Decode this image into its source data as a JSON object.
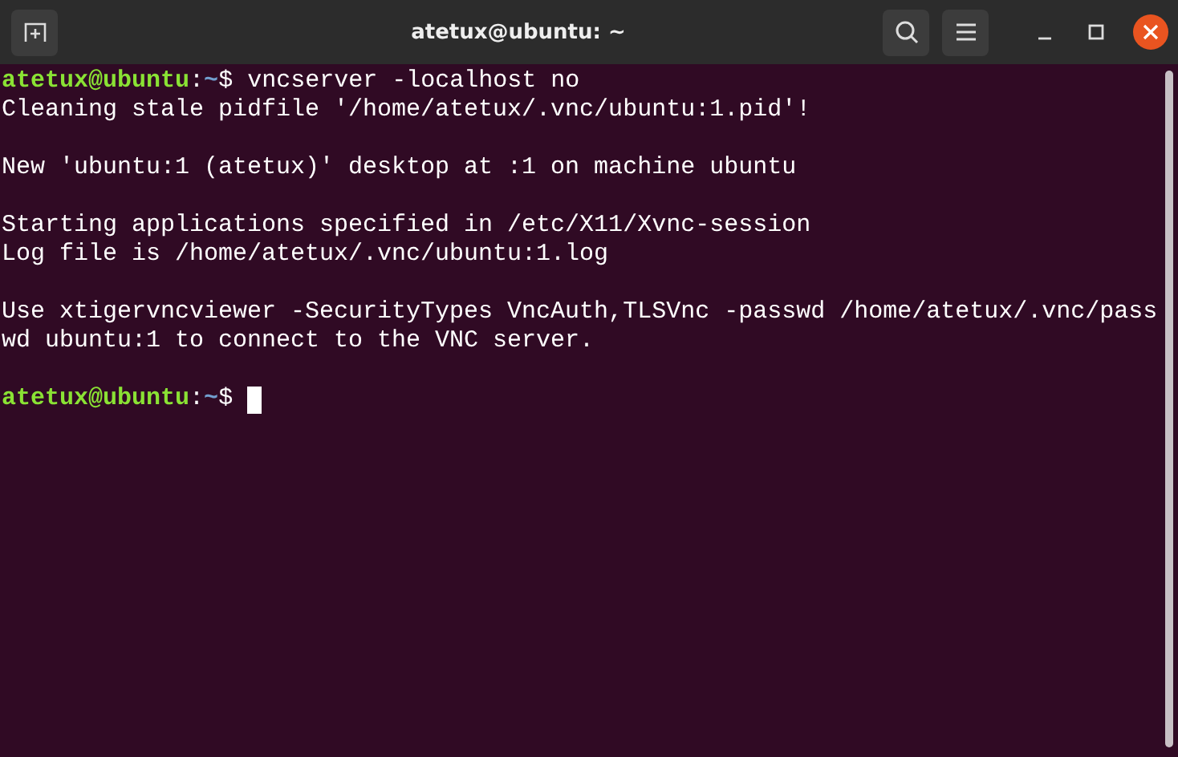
{
  "window": {
    "title": "atetux@ubuntu: ~"
  },
  "terminal": {
    "lines": [
      {
        "kind": "text",
        "segments": [
          {
            "kind": "user",
            "text": "atetux@ubuntu"
          },
          {
            "kind": "plain",
            "text": ":"
          },
          {
            "kind": "path",
            "text": "~"
          },
          {
            "kind": "plain",
            "text": "$ vncserver -localhost no"
          }
        ]
      },
      {
        "kind": "text",
        "segments": [
          {
            "kind": "plain",
            "text": "Cleaning stale pidfile '/home/atetux/.vnc/ubuntu:1.pid'!"
          }
        ]
      },
      {
        "kind": "blank"
      },
      {
        "kind": "text",
        "segments": [
          {
            "kind": "plain",
            "text": "New 'ubuntu:1 (atetux)' desktop at :1 on machine ubuntu"
          }
        ]
      },
      {
        "kind": "blank"
      },
      {
        "kind": "text",
        "segments": [
          {
            "kind": "plain",
            "text": "Starting applications specified in /etc/X11/Xvnc-session"
          }
        ]
      },
      {
        "kind": "text",
        "segments": [
          {
            "kind": "plain",
            "text": "Log file is /home/atetux/.vnc/ubuntu:1.log"
          }
        ]
      },
      {
        "kind": "blank"
      },
      {
        "kind": "text",
        "segments": [
          {
            "kind": "plain",
            "text": "Use xtigervncviewer -SecurityTypes VncAuth,TLSVnc -passwd /home/atetux/.vnc/pass"
          }
        ]
      },
      {
        "kind": "text",
        "segments": [
          {
            "kind": "plain",
            "text": "wd ubuntu:1 to connect to the VNC server."
          }
        ]
      },
      {
        "kind": "blank"
      },
      {
        "kind": "text",
        "cursor": true,
        "segments": [
          {
            "kind": "user",
            "text": "atetux@ubuntu"
          },
          {
            "kind": "plain",
            "text": ":"
          },
          {
            "kind": "path",
            "text": "~"
          },
          {
            "kind": "plain",
            "text": "$ "
          }
        ]
      }
    ]
  }
}
